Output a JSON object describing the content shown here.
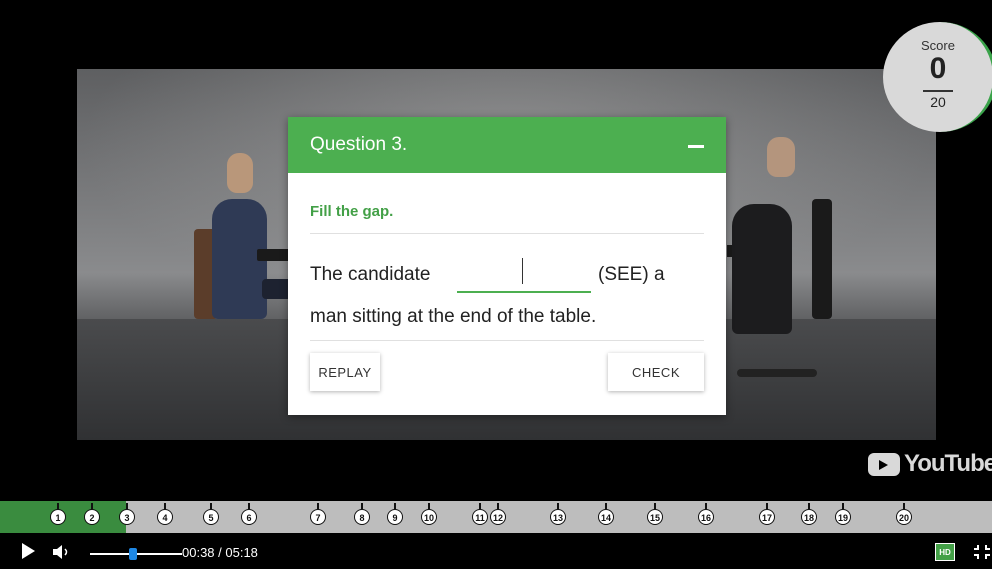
{
  "score": {
    "label": "Score",
    "value": "0",
    "total": "20"
  },
  "question": {
    "title": "Question 3.",
    "instruction": "Fill the gap.",
    "sentence_before": "The candidate",
    "sentence_after": "(SEE) a",
    "sentence_line2": "man sitting at the end of the table.",
    "input_value": "",
    "replay_label": "REPLAY",
    "check_label": "CHECK"
  },
  "branding": {
    "youtube": "YouTube"
  },
  "markers": [
    "1",
    "2",
    "3",
    "4",
    "5",
    "6",
    "7",
    "8",
    "9",
    "10",
    "11",
    "12",
    "13",
    "14",
    "15",
    "16",
    "17",
    "18",
    "19",
    "20"
  ],
  "player": {
    "time": "00:38 / 05:18",
    "hd_label": "HD",
    "played_fraction": 0.12,
    "volume_fraction": 0.48
  },
  "colors": {
    "accent": "#4caf50",
    "progress": "#3a8c3f",
    "volume_knob": "#1e88e5"
  }
}
